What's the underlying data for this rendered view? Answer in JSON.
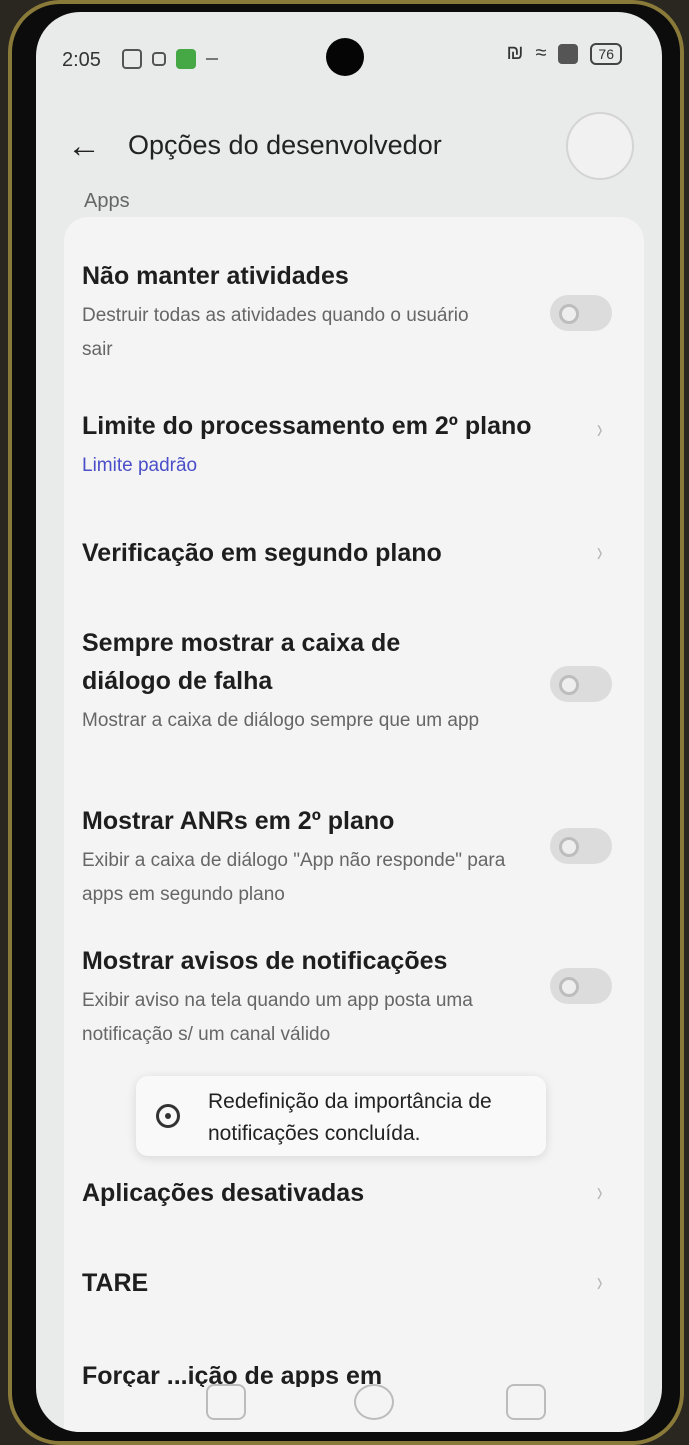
{
  "status_bar": {
    "time": "2:05",
    "battery": "76",
    "nfc_glyph": "₪",
    "wifi_glyph": "≈"
  },
  "app_bar": {
    "back_glyph": "←",
    "title": "Opções do desenvolvedor"
  },
  "section": {
    "label": "Apps"
  },
  "settings": {
    "dont_keep_activities": {
      "title": "Não manter atividades",
      "description": "Destruir todas as atividades quando o usuário sair",
      "enabled": false
    },
    "background_process_limit": {
      "title": "Limite do processamento em 2º plano",
      "value": "Limite padrão"
    },
    "background_check": {
      "title": "Verificação em segundo plano"
    },
    "show_crash_dialog": {
      "title": "Sempre mostrar a caixa de diálogo de falha",
      "description": "Mostrar a caixa de diálogo sempre que um app falha",
      "enabled": false
    },
    "background_anrs": {
      "title": "Mostrar ANRs em 2º plano",
      "description": "Exibir a caixa de diálogo \"App não responde\" para apps em segundo plano",
      "enabled": false
    },
    "notification_warnings": {
      "title": "Mostrar avisos de notificações",
      "description": "Exibir aviso na tela quando um app posta uma notificação s/ um canal válido",
      "enabled": false
    },
    "disabled_apps": {
      "title": "Aplicações desativadas"
    },
    "tare": {
      "title": "TARE"
    },
    "force_apps": {
      "title": "Forçar ...ição de apps em"
    }
  },
  "toast": {
    "text": "Redefinição da importância de notificações concluída."
  },
  "chevron_glyph": "›",
  "nav": {
    "recents": "recents",
    "home": "home",
    "back": "back"
  }
}
